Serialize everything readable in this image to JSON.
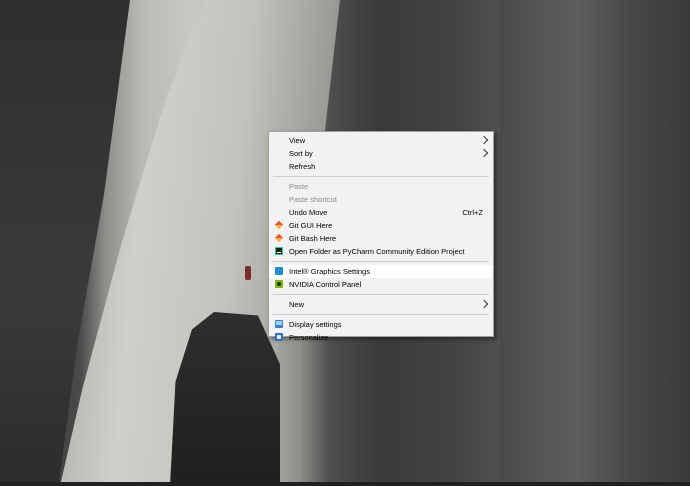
{
  "context_menu": {
    "view": "View",
    "sort_by": "Sort by",
    "refresh": "Refresh",
    "paste": "Paste",
    "paste_shortcut": "Paste shortcut",
    "undo_move": "Undo Move",
    "undo_move_shortcut": "Ctrl+Z",
    "git_gui_here": "Git GUI Here",
    "git_bash_here": "Git Bash Here",
    "open_folder_pycharm": "Open Folder as PyCharm Community Edition Project",
    "intel_graphics_settings": "Intel® Graphics Settings",
    "nvidia_control_panel": "NVIDIA Control Panel",
    "new": "New",
    "display_settings": "Display settings",
    "personalize": "Personalize"
  },
  "icons": {
    "git": "git-icon",
    "pycharm": "pycharm-icon",
    "intel": "intel-graphics-icon",
    "nvidia": "nvidia-icon",
    "display": "display-icon",
    "personalize": "personalize-icon"
  },
  "colors": {
    "menu_background": "#f2f2f2",
    "highlight": "#ffffff",
    "disabled_text": "#8a8a8a"
  }
}
